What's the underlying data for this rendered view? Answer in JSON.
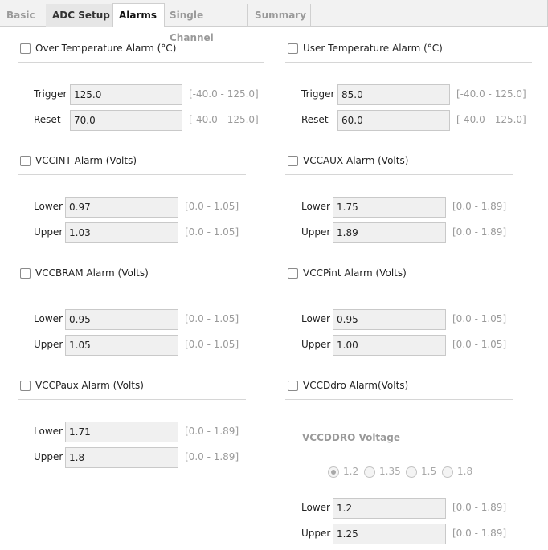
{
  "tabs": [
    {
      "label": "Basic"
    },
    {
      "label": "ADC Setup"
    },
    {
      "label": "Alarms"
    },
    {
      "label": "Single Channel"
    },
    {
      "label": "Summary"
    }
  ],
  "active_tab": "Alarms",
  "alarms": {
    "over_temp": {
      "label": "Over Temperature Alarm (°C)",
      "checked": false,
      "row1_label": "Trigger",
      "row1_value": "125.0",
      "row1_range": "[-40.0 - 125.0]",
      "row2_label": "Reset",
      "row2_value": "70.0",
      "row2_range": "[-40.0 - 125.0]"
    },
    "user_temp": {
      "label": "User Temperature Alarm (°C)",
      "checked": false,
      "row1_label": "Trigger",
      "row1_value": "85.0",
      "row1_range": "[-40.0 - 125.0]",
      "row2_label": "Reset",
      "row2_value": "60.0",
      "row2_range": "[-40.0 - 125.0]"
    },
    "vccint": {
      "label": "VCCINT Alarm (Volts)",
      "checked": false,
      "row1_label": "Lower",
      "row1_value": "0.97",
      "row1_range": "[0.0 - 1.05]",
      "row2_label": "Upper",
      "row2_value": "1.03",
      "row2_range": "[0.0 - 1.05]"
    },
    "vccaux": {
      "label": "VCCAUX Alarm (Volts)",
      "checked": false,
      "row1_label": "Lower",
      "row1_value": "1.75",
      "row1_range": "[0.0 - 1.89]",
      "row2_label": "Upper",
      "row2_value": "1.89",
      "row2_range": "[0.0 - 1.89]"
    },
    "vccbram": {
      "label": "VCCBRAM Alarm (Volts)",
      "checked": false,
      "row1_label": "Lower",
      "row1_value": "0.95",
      "row1_range": "[0.0 - 1.05]",
      "row2_label": "Upper",
      "row2_value": "1.05",
      "row2_range": "[0.0 - 1.05]"
    },
    "vccpint": {
      "label": "VCCPint Alarm (Volts)",
      "checked": false,
      "row1_label": "Lower",
      "row1_value": "0.95",
      "row1_range": "[0.0 - 1.05]",
      "row2_label": "Upper",
      "row2_value": "1.00",
      "row2_range": "[0.0 - 1.05]"
    },
    "vccpaux": {
      "label": "VCCPaux Alarm (Volts)",
      "checked": false,
      "row1_label": "Lower",
      "row1_value": "1.71",
      "row1_range": "[0.0 - 1.89]",
      "row2_label": "Upper",
      "row2_value": "1.8",
      "row2_range": "[0.0 - 1.89]"
    },
    "vccddro": {
      "label": "VCCDdro Alarm(Volts)",
      "checked": false,
      "voltage_heading": "VCCDDRO Voltage",
      "voltage_options": [
        "1.2",
        "1.35",
        "1.5",
        "1.8"
      ],
      "voltage_selected": "1.2",
      "row1_label": "Lower",
      "row1_value": "1.2",
      "row1_range": "[0.0 - 1.89]",
      "row2_label": "Upper",
      "row2_value": "1.25",
      "row2_range": "[0.0 - 1.89]"
    }
  },
  "colors": {
    "tab_bar": "#f2f2f2",
    "field_bg": "#f0f0f0",
    "disabled_text": "#9a9a9a"
  }
}
